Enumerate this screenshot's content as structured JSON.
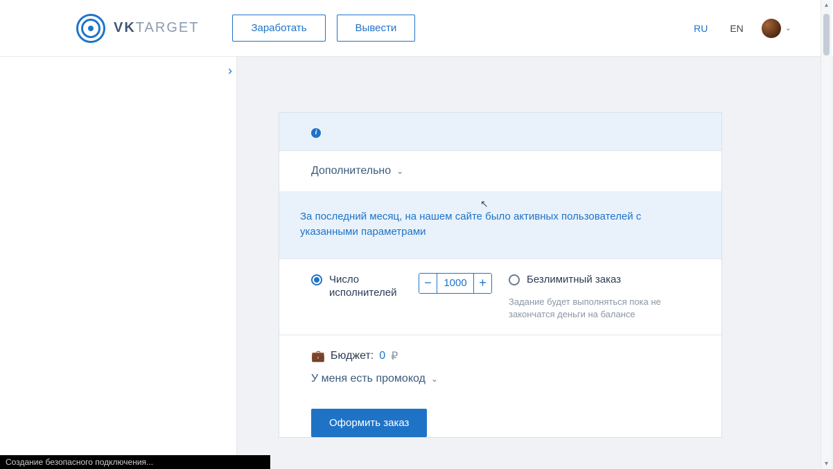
{
  "header": {
    "brand_prefix": "VK",
    "brand_suffix": "TARGET",
    "earn_label": "Заработать",
    "withdraw_label": "Вывести",
    "lang_ru": "RU",
    "lang_en": "EN"
  },
  "card": {
    "additional_label": "Дополнительно",
    "stats_text": "За последний месяц, на нашем сайте было   активных пользователей с указанными параметрами",
    "executors_label": "Число исполнителей",
    "executors_value": "1000",
    "stepper_minus": "−",
    "stepper_plus": "+",
    "unlimited_label": "Безлимитный заказ",
    "unlimited_hint": "Задание будет выполняться пока не закончатся деньги на балансе",
    "budget_label": "Бюджет:",
    "budget_value": "0",
    "budget_currency": "₽",
    "promo_label": "У меня есть промокод",
    "submit_label": "Оформить заказ"
  },
  "statusbar": {
    "text": "Создание безопасного подключения..."
  }
}
